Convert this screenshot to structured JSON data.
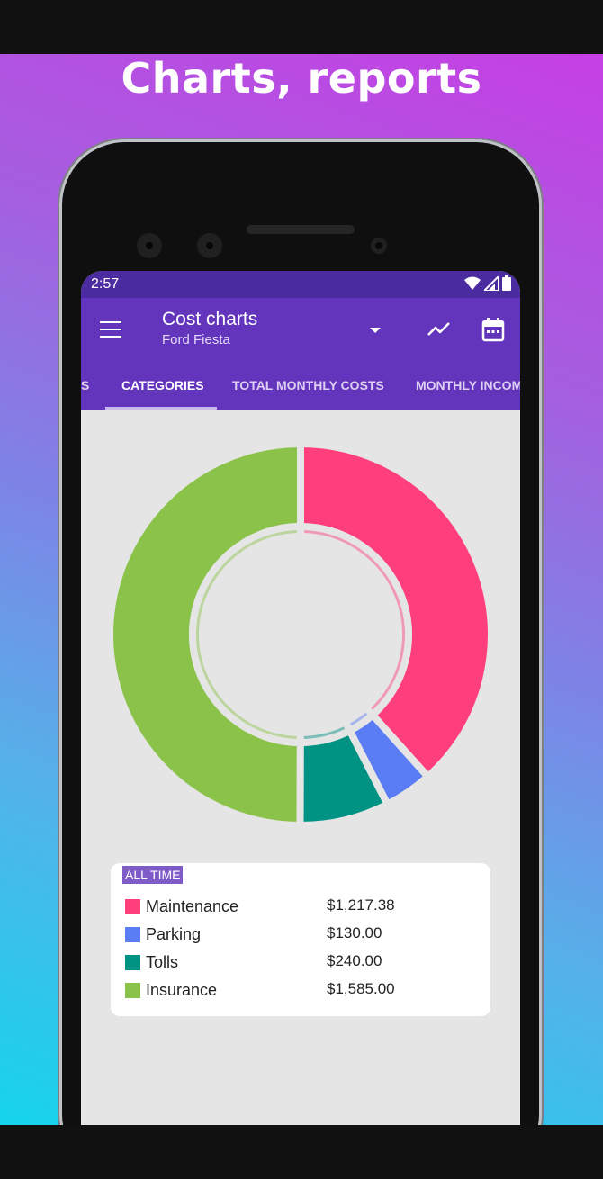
{
  "promo": {
    "headline": "Charts, reports"
  },
  "status": {
    "time": "2:57"
  },
  "appbar": {
    "title": "Cost charts",
    "subtitle": "Ford Fiesta"
  },
  "tabs": [
    {
      "label": "S"
    },
    {
      "label": "CATEGORIES"
    },
    {
      "label": "TOTAL MONTHLY COSTS"
    },
    {
      "label": "MONTHLY INCOM"
    }
  ],
  "chart_data": {
    "type": "pie",
    "categories": [
      "Maintenance",
      "Parking",
      "Tolls",
      "Insurance"
    ],
    "values": [
      1217.38,
      130.0,
      240.0,
      1585.0
    ],
    "colors": [
      "#ff3f7c",
      "#5a7cf4",
      "#009283",
      "#8bc34a"
    ]
  },
  "legend": {
    "badge": "ALL TIME",
    "items": [
      {
        "label": "Maintenance",
        "value": "$1,217.38",
        "color": "#ff3f7c"
      },
      {
        "label": "Parking",
        "value": "$130.00",
        "color": "#5a7cf4"
      },
      {
        "label": "Tolls",
        "value": "$240.00",
        "color": "#009283"
      },
      {
        "label": "Insurance",
        "value": "$1,585.00",
        "color": "#8bc34a"
      }
    ]
  },
  "icons": {
    "menu": "menu-icon",
    "dropdown": "dropdown-arrow-icon",
    "trend": "trending-line-icon",
    "calendar": "calendar-icon",
    "wifi": "wifi-icon",
    "signal": "signal-icon",
    "battery": "battery-icon"
  },
  "colors": {
    "primary": "#6335bd",
    "status_bar": "#4b2ba0",
    "screen_background": "#e5e5e5"
  }
}
